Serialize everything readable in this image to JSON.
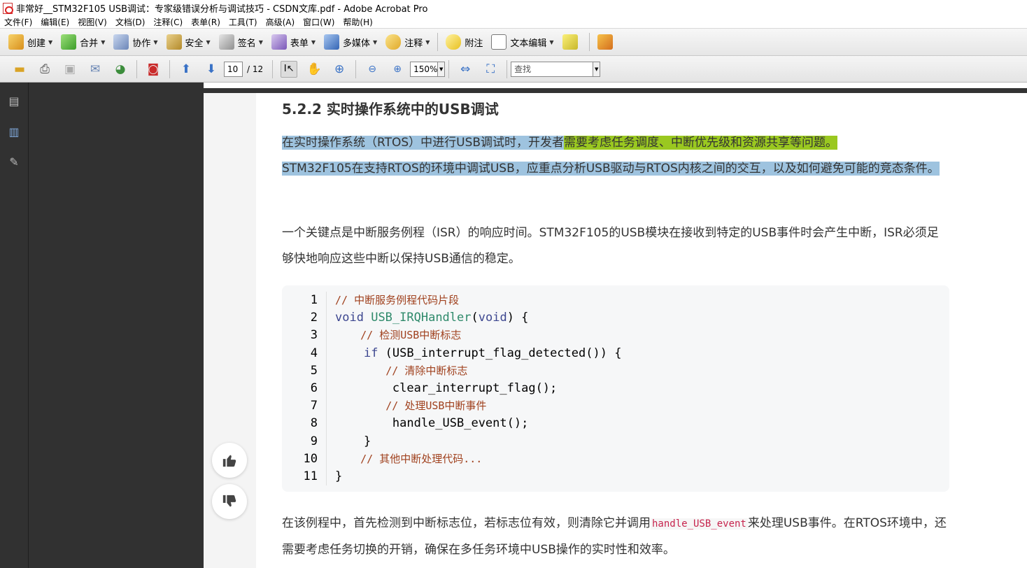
{
  "window": {
    "title": "非常好__STM32F105 USB调试：专家级错误分析与调试技巧 - CSDN文库.pdf - Adobe Acrobat Pro"
  },
  "menu": [
    "文件(F)",
    "编辑(E)",
    "视图(V)",
    "文档(D)",
    "注释(C)",
    "表单(R)",
    "工具(T)",
    "高级(A)",
    "窗口(W)",
    "帮助(H)"
  ],
  "toolbar1": {
    "create": "创建",
    "combine": "合并",
    "collaborate": "协作",
    "secure": "安全",
    "sign": "签名",
    "forms": "表单",
    "multimedia": "多媒体",
    "comment": "注释",
    "sticky_note": "附注",
    "text_edit": "文本编辑"
  },
  "toolbar2": {
    "page_current": "10",
    "page_total": "/ 12",
    "zoom": "150%",
    "find_placeholder": "查找"
  },
  "doc": {
    "heading": "5.2.2 实时操作系统中的USB调试",
    "p1_a": "在实时操作系统（RTOS）中进行USB调试时，开发者",
    "p1_b": "需要考虑任务调度、中断优先级和资源共享等问题。",
    "p1_c": "STM32F105在支持RTOS的环境中调试USB，应重点分析USB驱动与RTOS内核之间的交互，以及如何避免可能的竞态条件。",
    "p2": "一个关键点是中断服务例程（ISR）的响应时间。STM32F105的USB模块在接收到特定的USB事件时会产生中断，ISR必须足够快地响应这些中断以保持USB通信的稳定。",
    "p3_a": "在该例程中，首先检测到中断标志位，若标志位有效，则清除它并调用",
    "p3_code": "handle_USB_event",
    "p3_b": "来处理USB事件。在RTOS环境中，还需要考虑任务切换的开销，确保在多任务环境中USB操作的实时性和效率。"
  },
  "code": {
    "line_numbers": [
      "1",
      "2",
      "3",
      "4",
      "5",
      "6",
      "7",
      "8",
      "9",
      "10",
      "11"
    ],
    "l1": "// 中断服务例程代码片段",
    "l2_kw": "void",
    "l2_fn": "USB_IRQHandler",
    "l2_p1": "(",
    "l2_arg": "void",
    "l2_p2": ") {",
    "l3": "    // 检测USB中断标志",
    "l4_indent": "    ",
    "l4_kw": "if",
    "l4_rest": " (USB_interrupt_flag_detected()) {",
    "l5": "        // 清除中断标志",
    "l6": "        clear_interrupt_flag();",
    "l7": "        // 处理USB中断事件",
    "l8": "        handle_USB_event();",
    "l9": "    }",
    "l10": "    // 其他中断处理代码...",
    "l11": "}"
  },
  "colors": {
    "highlight_blue": "#9ec3df",
    "highlight_green": "#9ac820",
    "comment": "#a0411e",
    "keyword": "#3d4790",
    "function": "#2f8a6b",
    "inline_code": "#c7254e"
  }
}
